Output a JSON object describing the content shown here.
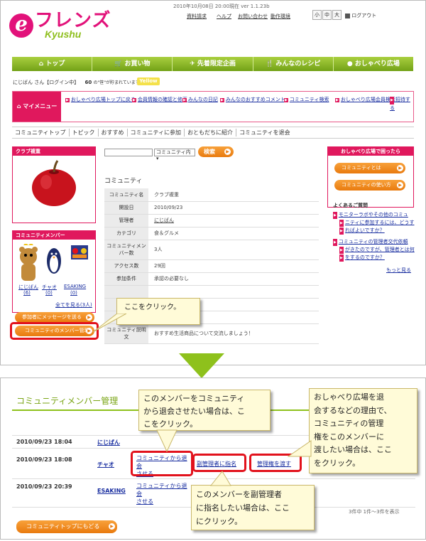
{
  "header": {
    "logo_mark": "e",
    "logo_text": "フレンズ",
    "logo_sub": "Kyushu",
    "version": "2010年10月08日 20:00現在 ver 1.1.23b",
    "utility_links": [
      "資料請求",
      "ヘルプ",
      "お問い合わせ",
      "動作環境"
    ],
    "font_sizes": [
      "小",
      "中",
      "大"
    ],
    "logout": "ログアウト"
  },
  "global_nav": [
    {
      "icon": "home-icon",
      "glyph": "⌂",
      "label": "トップ"
    },
    {
      "icon": "cart-icon",
      "glyph": "🛒",
      "label": "お買い物"
    },
    {
      "icon": "runner-icon",
      "glyph": "✈",
      "label": "先着限定企画"
    },
    {
      "icon": "fork-icon",
      "glyph": "🍴",
      "label": "みんなのレシピ"
    },
    {
      "icon": "speech-icon",
      "glyph": "●",
      "label": "おしゃべり広場"
    }
  ],
  "user": {
    "name_line": "にじばん さん【ログイン中】",
    "points": "60",
    "points_note": "の\"笹\"が貯まれています",
    "rank": "Yellow"
  },
  "my_menu": {
    "label": "マイメニュー",
    "icon_glyph": "⌂",
    "items": [
      "おしゃべり広場トップに戻る",
      "会員情報の確認と修正",
      "みんなの日記",
      "みんなのおすすめコメント",
      "コミュニティ検索",
      "おしゃべり広場会員検索",
      "招待する"
    ]
  },
  "sub_nav": [
    "コミュニティトップ",
    "トピック",
    "おすすめ",
    "コミュニティに参加",
    "おともだちに紹介",
    "コミュニティを退会"
  ],
  "club": {
    "heading": "クラブ複重"
  },
  "members_box": {
    "heading": "コミュニティメンバー",
    "members": [
      {
        "name": "にじばん",
        "count": "(6)"
      },
      {
        "name": "チャオ",
        "count": "(0)"
      },
      {
        "name": "ESAKING",
        "count": "(0)"
      }
    ],
    "see_all": "全てを見る(3人)",
    "message_btn": "参加者にメッセージを送る",
    "manage_btn": "コミュニティのメンバー管理"
  },
  "search": {
    "select_value": "コミュニティ内",
    "button": "検索"
  },
  "community": {
    "title": "コミュニティ",
    "rows": [
      {
        "k": "コミュニティ名",
        "v": "クラブ複重"
      },
      {
        "k": "開設日",
        "v": "2010/09/23"
      },
      {
        "k": "管理者",
        "v": "にじばん"
      },
      {
        "k": "カテゴリ",
        "v": "食＆グルメ"
      },
      {
        "k": "コミュニティメンバー数",
        "v": "3人"
      },
      {
        "k": "アクセス数",
        "v": "29回"
      },
      {
        "k": "参加条件",
        "v": "承認の必要なし"
      },
      {
        "k": "",
        "v": ""
      },
      {
        "k": "",
        "v": ""
      },
      {
        "k": "",
        "v": ""
      },
      {
        "k": "コミュニティ説明文",
        "v": "おすすめ生活商品について交流しましょう！"
      }
    ]
  },
  "right_box": {
    "heading": "おしゃべり広場で困ったら",
    "btn1": "コミュニティとは",
    "btn2": "コミュニティの使い方",
    "faq_title": "よくあるご質問",
    "faqs": [
      [
        "モニターラボやその他のコミュ",
        "ニティに参加するには、どうす",
        "ればよいですか？"
      ],
      [
        "コミュニティの管理者交代依頼",
        "がきたのですが、管理者とは何",
        "をするのですか？"
      ]
    ],
    "more": "もっと見る"
  },
  "callout_click": "ここをクリック。",
  "bottom": {
    "title": "コミュニティメンバー管理",
    "rows": [
      {
        "date": "2010/09/23 18:04",
        "name": "にじばん",
        "remove": [
          "",
          ""
        ]
      },
      {
        "date": "2010/09/23 18:08",
        "name": "チャオ",
        "remove": [
          "コミュニティから退会",
          "させる"
        ],
        "deputy": "副管理者に指名",
        "transfer": "管理権を渡す"
      },
      {
        "date": "2010/09/23 20:39",
        "name": "ESAKING",
        "remove": [
          "コミュニティから退会",
          "させる"
        ]
      }
    ],
    "count_text": "3件中 1件～3件を表示",
    "back_btn": "コミュニティトップにもどる",
    "callout_remove": [
      "このメンバーをコミュニティ",
      "から退会させたい場合は、こ",
      "こをクリック。"
    ],
    "callout_transfer": [
      "おしゃべり広場を退",
      "会するなどの理由で、",
      "コミュニティの管理",
      "権をこのメンバーに",
      "渡したい場合は、ここ",
      "をクリック。"
    ],
    "callout_deputy": [
      "このメンバーを副管理者",
      "に指名したい場合は、ここ",
      "にクリック。"
    ]
  },
  "colors": {
    "accent": "#e0185d",
    "nav_green": "#8ec11c",
    "button_orange": "#f08c22",
    "highlight_red": "#e2121c",
    "callout_bg": "#fffbd8"
  }
}
